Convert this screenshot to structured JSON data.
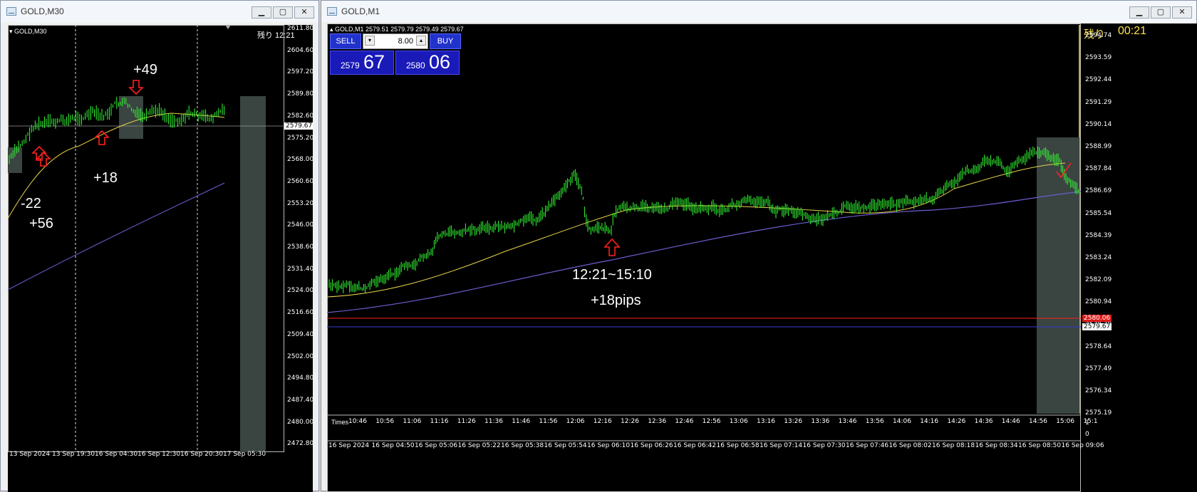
{
  "left_window": {
    "title": "GOLD,M30",
    "symbol_label": "GOLD,M30",
    "remaining": "残り 12:21",
    "current_price_tag": "2579.67",
    "y_ticks": [
      "2611.80",
      "2604.60",
      "2597.20",
      "2589.80",
      "2582.60",
      "2575.20",
      "2568.00",
      "2560.60",
      "2553.20",
      "2546.00",
      "2538.60",
      "2531.40",
      "2524.00",
      "2516.60",
      "2509.40",
      "2502.00",
      "2494.80",
      "2487.40",
      "2480.00",
      "2472.80"
    ],
    "x_ticks": [
      "13 Sep 2024",
      "13 Sep 19:30",
      "16 Sep 04:30",
      "16 Sep 12:30",
      "16 Sep 20:30",
      "17 Sep 05:30"
    ],
    "annotations": [
      "+49",
      "+18",
      "-22",
      "+56"
    ]
  },
  "right_window": {
    "title": "GOLD,M1",
    "info_line": "GOLD,M1  2579.51 2579.79 2579.49 2579.67",
    "remaining_label": "残り",
    "remaining_time": "00:21",
    "sell_label": "SELL",
    "buy_label": "BUY",
    "lot_value": "8.00",
    "sell_price_small": "2579",
    "sell_price_big": "67",
    "buy_price_small": "2580",
    "buy_price_big": "06",
    "ask_tag": "2580.06",
    "bid_tag": "2579.67",
    "y_ticks": [
      "2594.74",
      "2593.59",
      "2592.44",
      "2591.29",
      "2590.14",
      "2588.99",
      "2587.84",
      "2586.69",
      "2585.54",
      "2584.39",
      "2583.24",
      "2582.09",
      "2580.94",
      "2579.79",
      "2578.64",
      "2577.49",
      "2576.34",
      "2575.19"
    ],
    "times_label": "Times",
    "times_ticks": [
      "10:46",
      "10:56",
      "11:06",
      "11:16",
      "11:26",
      "11:36",
      "11:46",
      "11:56",
      "12:06",
      "12:16",
      "12:26",
      "12:36",
      "12:46",
      "12:56",
      "13:06",
      "13:16",
      "13:26",
      "13:36",
      "13:46",
      "13:56",
      "14:06",
      "14:16",
      "14:26",
      "14:36",
      "14:46",
      "14:56",
      "15:06",
      "15:1"
    ],
    "sub_y_ticks": [
      "1",
      "0"
    ],
    "x_ticks": [
      "16 Sep 2024",
      "16 Sep 04:50",
      "16 Sep 05:06",
      "16 Sep 05:22",
      "16 Sep 05:38",
      "16 Sep 05:54",
      "16 Sep 06:10",
      "16 Sep 06:26",
      "16 Sep 06:42",
      "16 Sep 06:58",
      "16 Sep 07:14",
      "16 Sep 07:30",
      "16 Sep 07:46",
      "16 Sep 08:02",
      "16 Sep 08:18",
      "16 Sep 08:34",
      "16 Sep 08:50",
      "16 Sep 09:06"
    ],
    "annotation_time": "12:21~15:10",
    "annotation_pips": "+18pips"
  },
  "colors": {
    "candle": "#33ff33",
    "ma_fast": "#e8d24a",
    "ma_slow": "#6a5fd0",
    "ask_line": "#ff2222",
    "bid_line": "#3a3ad0",
    "arrow": "#ff2020",
    "highlight": "#3a4440"
  }
}
